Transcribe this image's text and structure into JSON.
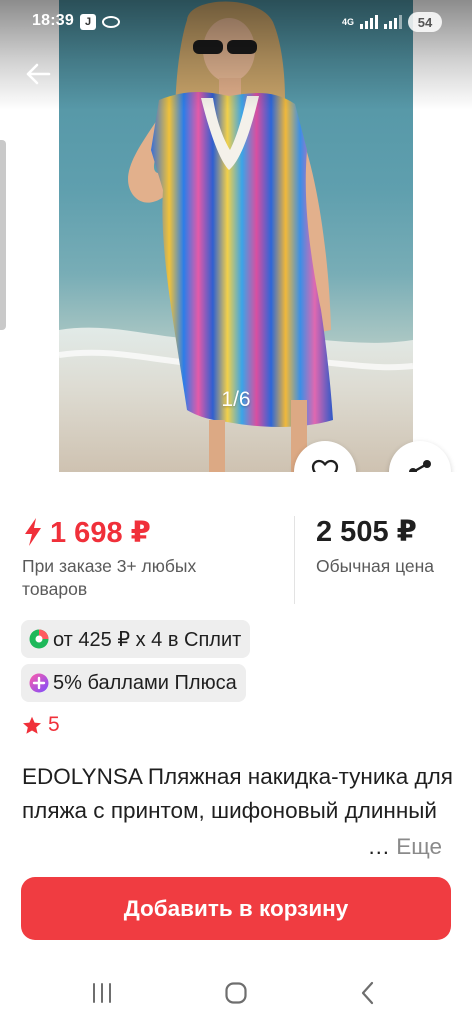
{
  "status_bar": {
    "time": "18:39",
    "network": "4G",
    "battery": "54"
  },
  "gallery": {
    "counter": "1/6"
  },
  "price": {
    "current": "1 698 ₽",
    "condition": "При заказе 3+ любых товаров",
    "regular": "2 505 ₽",
    "regular_label": "Обычная цена",
    "accent_color": "#f0303a"
  },
  "split": {
    "text": "от 425 ₽ x 4 в Сплит"
  },
  "plus": {
    "text": "5% баллами Плюса"
  },
  "rating": {
    "value": "5"
  },
  "product": {
    "title": "EDOLYNSA Пляжная накидка-туника для пляжа с принтом, шифоновый длинный",
    "ellipsis": "…",
    "more": "Еще"
  },
  "cta": {
    "label": "Добавить в корзину",
    "color": "#f03c41"
  },
  "icons": {
    "back": "arrow-left",
    "favorite": "heart-outline",
    "share": "share-nodes",
    "price": "lightning-bolt",
    "rating": "star",
    "split": "split-logo",
    "plus": "plus-logo"
  }
}
